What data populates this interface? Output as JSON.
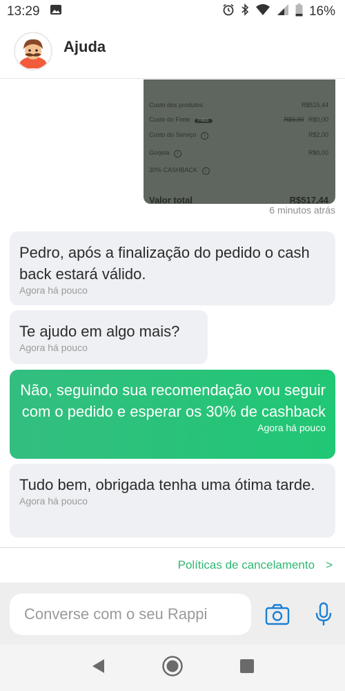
{
  "status_bar": {
    "time": "13:29",
    "battery": "16%"
  },
  "header": {
    "title": "Ajuda"
  },
  "receipt": {
    "rows": [
      {
        "label": "Custo dos produtos",
        "value": "R$515,44"
      },
      {
        "label": "Custo do Frete",
        "badge": "FREE",
        "old_value": "R$9,90",
        "value": "R$0,00"
      },
      {
        "label": "Custo do Serviço",
        "value": "R$2,00"
      },
      {
        "label": "Gorjeta",
        "value": "R$0,00"
      },
      {
        "label": "30% CASHBACK",
        "value": ""
      },
      {
        "label": "Valor total",
        "value": "R$517,44"
      }
    ],
    "time": "6 minutos atrás"
  },
  "messages": [
    {
      "direction": "in",
      "text": "Pedro, após a finalização do pedido o cash back estará válido.",
      "time": "Agora há pouco"
    },
    {
      "direction": "in",
      "text": "Te ajudo em algo mais?",
      "time": "Agora há pouco"
    },
    {
      "direction": "out",
      "text": "Não, seguindo sua recomendação vou seguir com o pedido e esperar os 30% de cashback",
      "time": "Agora há pouco"
    },
    {
      "direction": "in",
      "text": "Tudo bem, obrigada tenha uma ótima tarde.",
      "time": "Agora há pouco"
    }
  ],
  "policy_link": {
    "label": "Políticas de cancelamento",
    "chevron": ">"
  },
  "composer": {
    "placeholder": "Converse com o seu Rappi"
  },
  "colors": {
    "accent": "#2eb872",
    "bubble_out": "#20c774",
    "bubble_in": "#eef0f3"
  },
  "icons": {
    "status_left": [
      "image-icon"
    ],
    "status_right": [
      "alarm-icon",
      "bluetooth-icon",
      "wifi-icon",
      "signal-icon",
      "battery-icon"
    ],
    "composer": [
      "camera-icon",
      "microphone-icon"
    ],
    "nav": [
      "back-icon",
      "home-icon",
      "recents-icon"
    ]
  }
}
